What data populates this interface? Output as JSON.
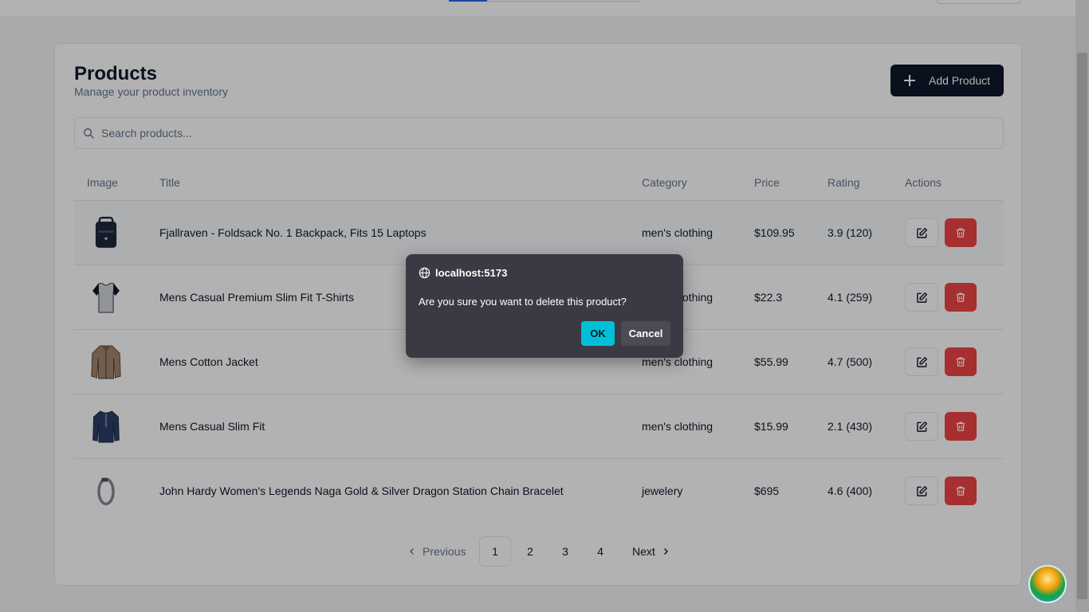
{
  "header": {
    "title": "Products",
    "subtitle": "Manage your product inventory",
    "add_button_label": "Add Product"
  },
  "search": {
    "placeholder": "Search products..."
  },
  "table": {
    "columns": {
      "image": "Image",
      "title": "Title",
      "category": "Category",
      "price": "Price",
      "rating": "Rating",
      "actions": "Actions"
    },
    "rows": [
      {
        "title": "Fjallraven - Foldsack No. 1 Backpack, Fits 15 Laptops",
        "category": "men's clothing",
        "price": "$109.95",
        "rating": "3.9 (120)",
        "image_icon": "backpack"
      },
      {
        "title": "Mens Casual Premium Slim Fit T-Shirts",
        "category": "men's clothing",
        "price": "$22.3",
        "rating": "4.1 (259)",
        "image_icon": "tshirt"
      },
      {
        "title": "Mens Cotton Jacket",
        "category": "men's clothing",
        "price": "$55.99",
        "rating": "4.7 (500)",
        "image_icon": "jacket"
      },
      {
        "title": "Mens Casual Slim Fit",
        "category": "men's clothing",
        "price": "$15.99",
        "rating": "2.1 (430)",
        "image_icon": "long-sleeve-shirt"
      },
      {
        "title": "John Hardy Women's Legends Naga Gold & Silver Dragon Station Chain Bracelet",
        "category": "jewelery",
        "price": "$695",
        "rating": "4.6 (400)",
        "image_icon": "bracelet"
      }
    ]
  },
  "pagination": {
    "previous": "Previous",
    "pages": [
      "1",
      "2",
      "3",
      "4"
    ],
    "current": "1",
    "next": "Next"
  },
  "dialog": {
    "origin": "localhost:5173",
    "message": "Are you sure you want to delete this product?",
    "ok_label": "OK",
    "cancel_label": "Cancel"
  },
  "colors": {
    "primary": "#0f172a",
    "destructive": "#ef4444",
    "dialog_bg": "#3b3a44",
    "dialog_ok": "#00c0d8"
  }
}
